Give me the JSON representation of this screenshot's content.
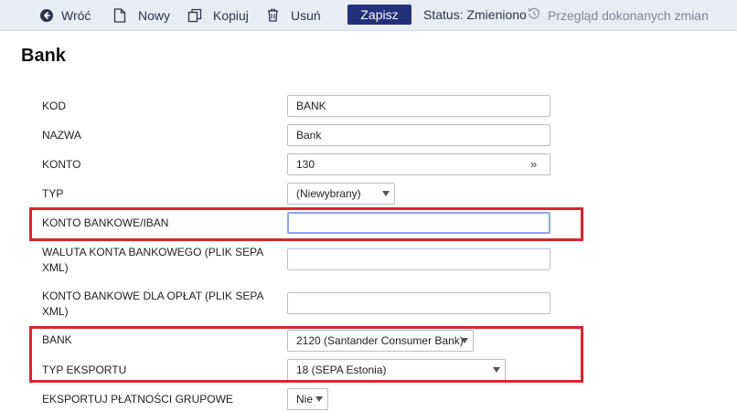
{
  "toolbar": {
    "back_label": "Wróć",
    "new_label": "Nowy",
    "copy_label": "Kopiuj",
    "delete_label": "Usuń",
    "save_label": "Zapisz",
    "status_text": "Status: Zmieniono",
    "history_label": "Przegląd dokonanych zmian",
    "icons": [
      "back-arrow-icon",
      "new-document-icon",
      "copy-icon",
      "trash-icon",
      "history-icon"
    ]
  },
  "page": {
    "title": "Bank"
  },
  "form": {
    "kod": {
      "label": "KOD",
      "value": "BANK"
    },
    "nazwa": {
      "label": "NAZWA",
      "value": "Bank"
    },
    "konto": {
      "label": "KONTO",
      "value": "130",
      "link_icon": "»"
    },
    "typ": {
      "label": "TYP",
      "selected": "(Niewybrany)"
    },
    "iban": {
      "label": "KONTO BANKOWE/IBAN",
      "value": ""
    },
    "waluta": {
      "label": "WALUTA KONTA BANKOWEGO (PLIK SEPA XML)",
      "value": ""
    },
    "konto_oplat": {
      "label": "KONTO BANKOWE DLA OPŁAT (PLIK SEPA XML)",
      "value": ""
    },
    "bank": {
      "label": "BANK",
      "selected": "2120 (Santander Consumer Bank)"
    },
    "typ_eksportu": {
      "label": "TYP EKSPORTU",
      "selected": "18 (SEPA Estonia)"
    },
    "eksportuj": {
      "label": "EKSPORTUJ PŁATNOŚCI GRUPOWE",
      "selected": "Nie"
    }
  },
  "colors": {
    "toolbar_bg": "#e8ecf4",
    "save_button": "#22307a",
    "highlight": "#d9262c"
  }
}
